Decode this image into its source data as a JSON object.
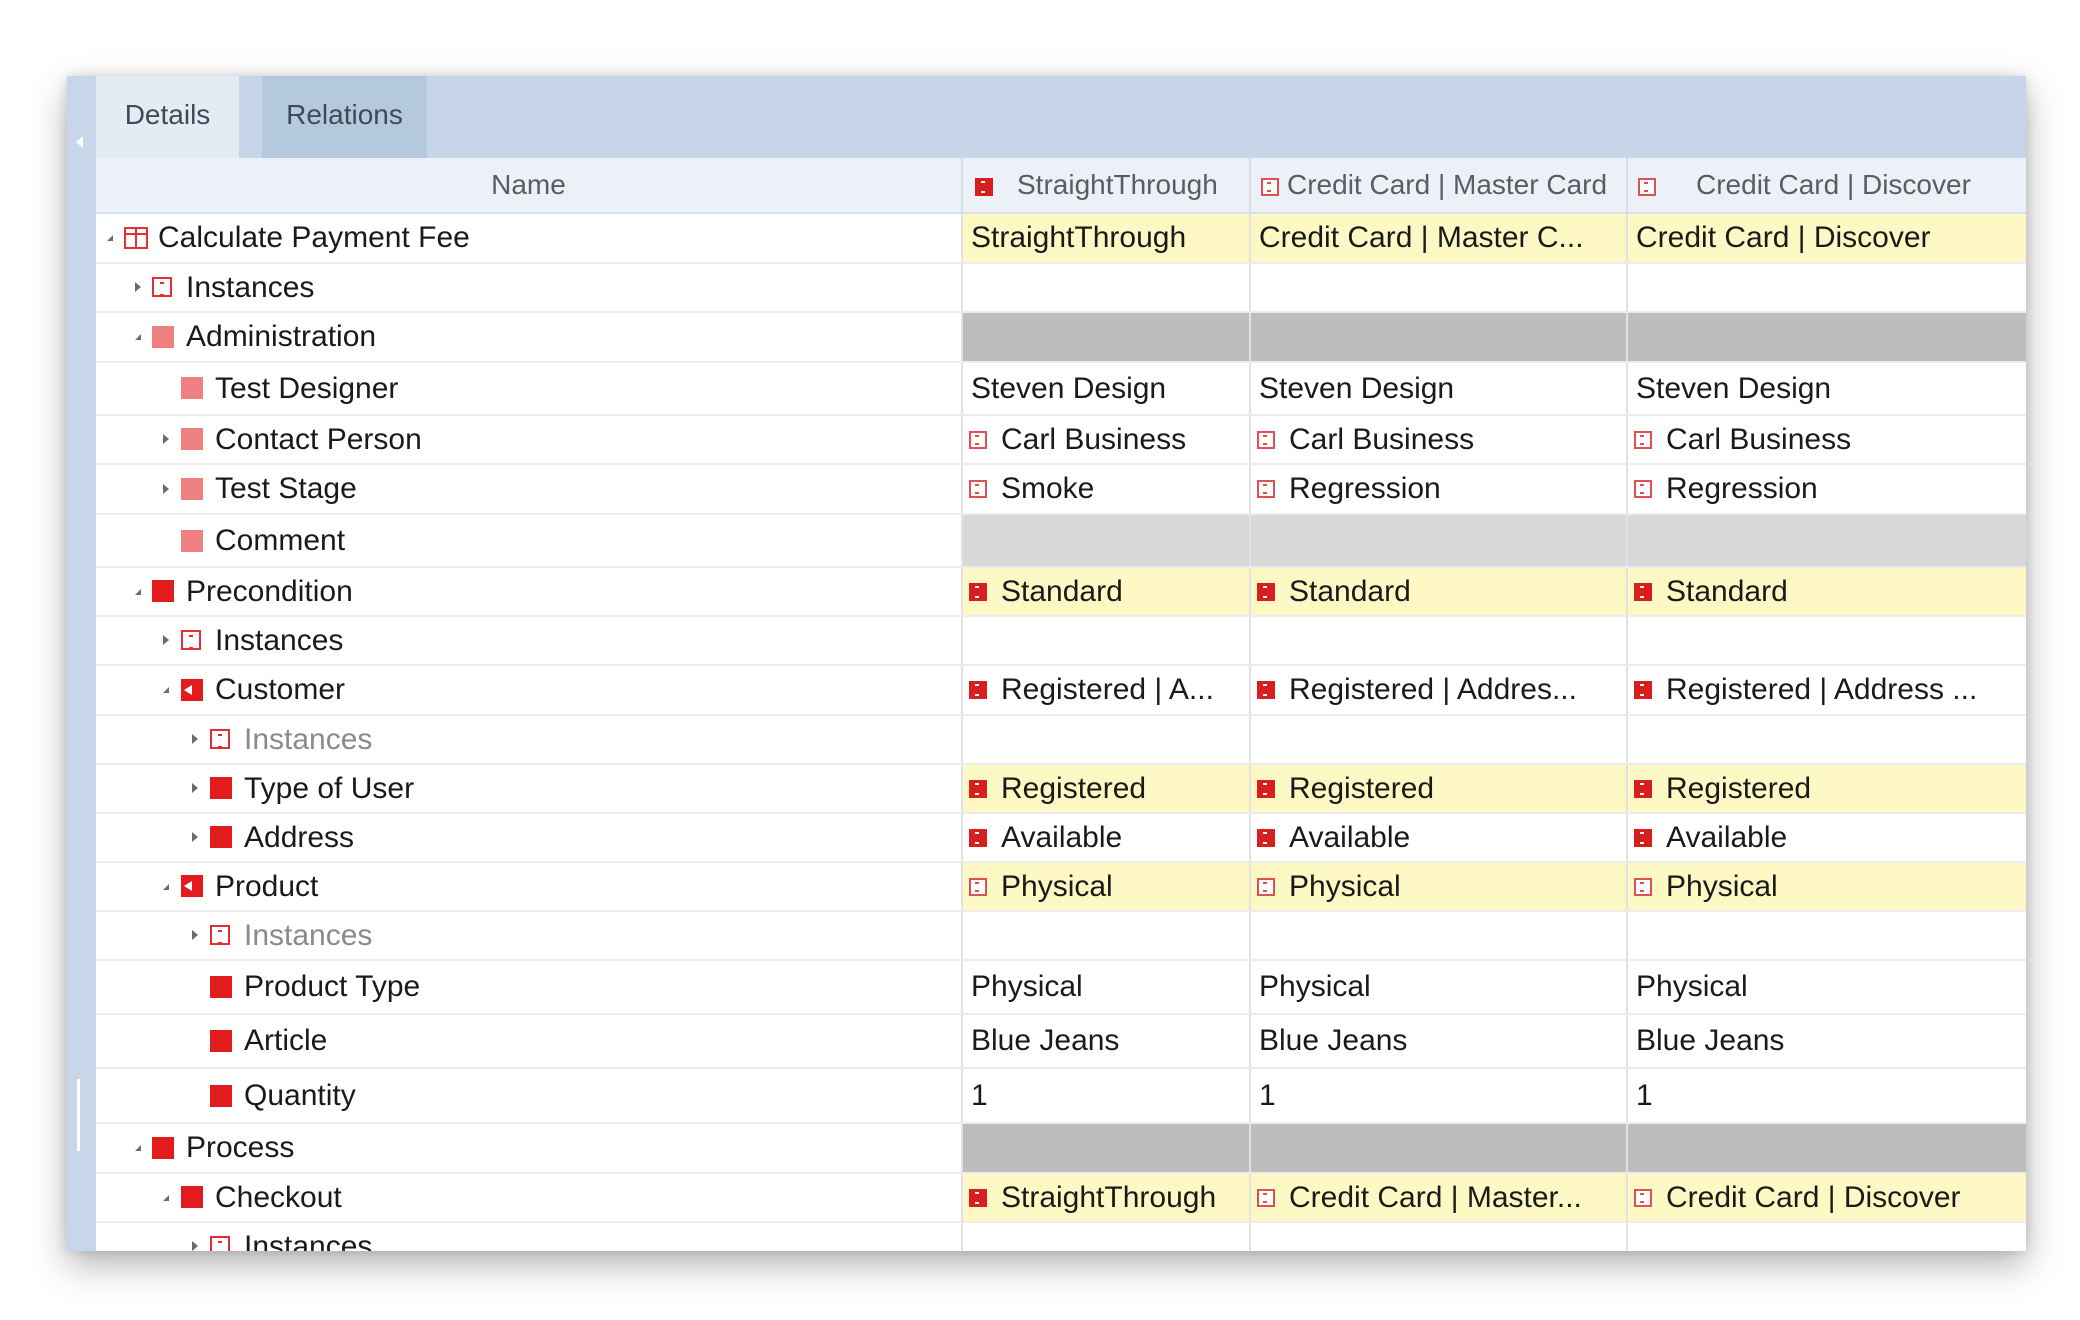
{
  "tabs": {
    "details": "Details",
    "relations": "Relations"
  },
  "header": {
    "name": "Name",
    "col1": "StraightThrough",
    "col2": "Credit Card | Master Card",
    "col3": "Credit Card | Discover"
  },
  "rows": [
    {
      "label": "Calculate Payment Fee",
      "v1": "StraightThrough",
      "v2": "Credit Card | Master C...",
      "v3": "Credit Card | Discover"
    },
    {
      "label": "Instances"
    },
    {
      "label": "Administration"
    },
    {
      "label": "Test Designer",
      "v1": "Steven Design",
      "v2": "Steven Design",
      "v3": "Steven Design"
    },
    {
      "label": "Contact Person",
      "v1": "Carl Business",
      "v2": "Carl Business",
      "v3": "Carl Business"
    },
    {
      "label": "Test Stage",
      "v1": "Smoke",
      "v2": "Regression",
      "v3": "Regression"
    },
    {
      "label": "Comment"
    },
    {
      "label": "Precondition",
      "v1": "Standard",
      "v2": "Standard",
      "v3": "Standard"
    },
    {
      "label": "Instances"
    },
    {
      "label": "Customer",
      "v1": "Registered | A...",
      "v2": "Registered | Addres...",
      "v3": "Registered | Address ..."
    },
    {
      "label": "Instances"
    },
    {
      "label": "Type of User",
      "v1": "Registered",
      "v2": "Registered",
      "v3": "Registered"
    },
    {
      "label": "Address",
      "v1": "Available",
      "v2": "Available",
      "v3": "Available"
    },
    {
      "label": "Product",
      "v1": "Physical",
      "v2": "Physical",
      "v3": "Physical"
    },
    {
      "label": "Instances"
    },
    {
      "label": "Product Type",
      "v1": "Physical",
      "v2": "Physical",
      "v3": "Physical"
    },
    {
      "label": "Article",
      "v1": "Blue Jeans",
      "v2": "Blue Jeans",
      "v3": "Blue Jeans"
    },
    {
      "label": "Quantity",
      "v1": "1",
      "v2": "1",
      "v3": "1"
    },
    {
      "label": "Process"
    },
    {
      "label": "Checkout",
      "v1": "StraightThrough",
      "v2": "Credit Card | Master...",
      "v3": "Credit Card | Discover"
    },
    {
      "label": "Instances"
    }
  ]
}
